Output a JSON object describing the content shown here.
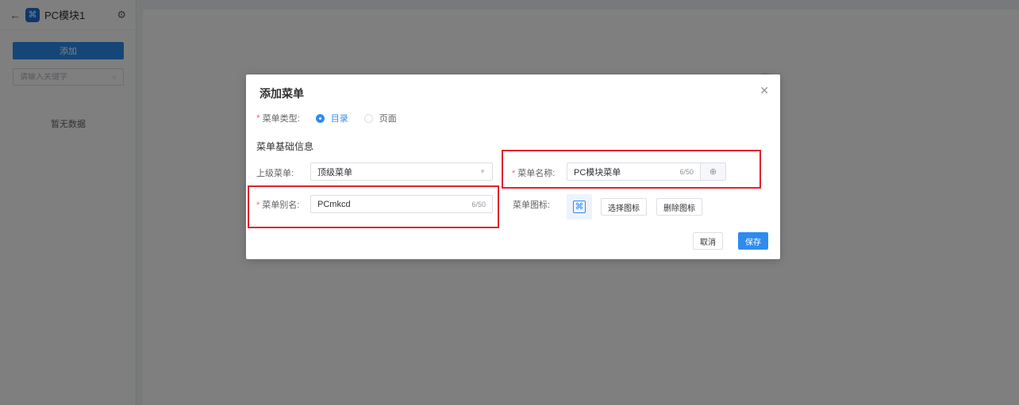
{
  "sidebar": {
    "app_title": "PC模块1",
    "add_label": "添加",
    "search_placeholder": "请输入关键字",
    "empty_text": "暂无数据"
  },
  "dialog": {
    "title": "添加菜单",
    "menu_type": {
      "label": "菜单类型:",
      "options": [
        "目录",
        "页面"
      ],
      "selected": "目录"
    },
    "section_title": "菜单基础信息",
    "parent_menu": {
      "label": "上级菜单:",
      "value": "顶级菜单"
    },
    "menu_name": {
      "label": "菜单名称:",
      "value": "PC模块菜单",
      "count": "6/50"
    },
    "menu_alias": {
      "label": "菜单别名:",
      "value": "PCmkcd",
      "count": "6/50"
    },
    "menu_icon": {
      "label": "菜单图标:",
      "icon": "command-icon",
      "choose_label": "选择图标",
      "delete_label": "删除图标"
    },
    "cancel_label": "取消",
    "save_label": "保存"
  },
  "colors": {
    "primary": "#2d8cf0",
    "highlight": "#e0242b",
    "required": "#f56c6c"
  }
}
